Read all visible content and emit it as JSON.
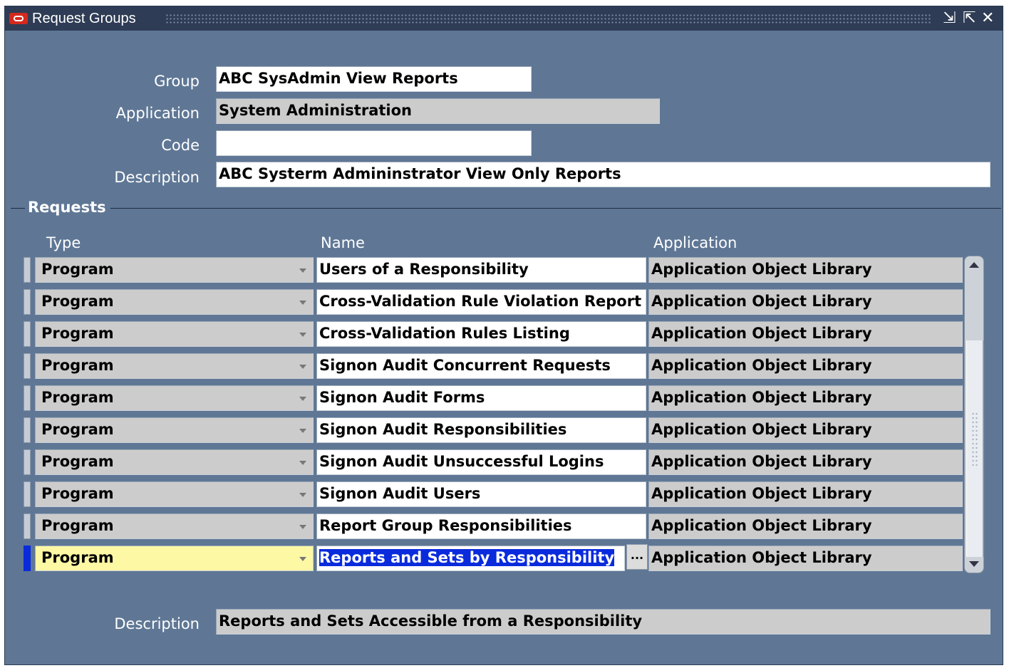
{
  "window": {
    "title": "Request Groups"
  },
  "form": {
    "group_label": "Group",
    "group_value": "ABC SysAdmin View Reports",
    "application_label": "Application",
    "application_value": "System Administration",
    "code_label": "Code",
    "code_value": "",
    "description_label": "Description",
    "description_value": "ABC Systerm Admininstrator View Only Reports"
  },
  "requests": {
    "section_title": "Requests",
    "columns": {
      "type": "Type",
      "name": "Name",
      "application": "Application"
    },
    "rows": [
      {
        "type": "Program",
        "name": "Users of a Responsibility",
        "application": "Application Object Library"
      },
      {
        "type": "Program",
        "name": "Cross-Validation Rule Violation Report",
        "application": "Application Object Library"
      },
      {
        "type": "Program",
        "name": "Cross-Validation Rules Listing",
        "application": "Application Object Library"
      },
      {
        "type": "Program",
        "name": "Signon Audit Concurrent Requests",
        "application": "Application Object Library"
      },
      {
        "type": "Program",
        "name": "Signon Audit Forms",
        "application": "Application Object Library"
      },
      {
        "type": "Program",
        "name": "Signon Audit Responsibilities",
        "application": "Application Object Library"
      },
      {
        "type": "Program",
        "name": "Signon Audit Unsuccessful Logins",
        "application": "Application Object Library"
      },
      {
        "type": "Program",
        "name": "Signon Audit Users",
        "application": "Application Object Library"
      },
      {
        "type": "Program",
        "name": "Report Group Responsibilities",
        "application": "Application Object Library"
      },
      {
        "type": "Program",
        "name": "Reports and Sets by Responsibility",
        "application": "Application Object Library"
      }
    ],
    "current_row_index": 9,
    "lov_button": "...",
    "description_label": "Description",
    "description_value": "Reports and Sets Accessible from a Responsibility"
  },
  "colors": {
    "window_bg": "#5f7795",
    "titlebar": "#2e3c55",
    "current_field": "#fdf8a4",
    "selection": "#0a2bdc"
  }
}
